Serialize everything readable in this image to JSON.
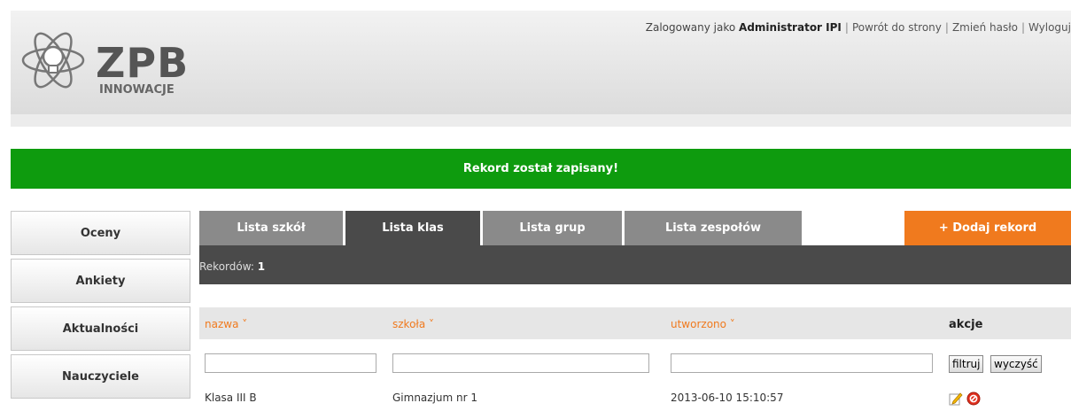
{
  "header": {
    "logo_title": "ZPB",
    "logo_subtitle": "INNOWACJE",
    "user_prefix": "Zalogowany jako",
    "user_name": "Administrator IPI",
    "links": [
      "Powrót do strony",
      "Zmień hasło",
      "Wyloguj"
    ]
  },
  "flash": {
    "message": "Rekord został zapisany!",
    "color": "#0e9b0e"
  },
  "sidebar": {
    "items": [
      {
        "label": "Oceny"
      },
      {
        "label": "Ankiety"
      },
      {
        "label": "Aktualności"
      },
      {
        "label": "Nauczyciele"
      }
    ]
  },
  "tabs": [
    {
      "label": "Lista szkół",
      "active": false
    },
    {
      "label": "Lista klas",
      "active": true
    },
    {
      "label": "Lista grup",
      "active": false
    },
    {
      "label": "Lista zespołów",
      "active": false
    }
  ],
  "add_button": {
    "label": "+  Dodaj rekord",
    "color": "#f07a1e"
  },
  "records": {
    "label": "Rekordów:",
    "count": "1"
  },
  "table": {
    "columns": [
      "nazwa ˅",
      "szkoła ˅",
      "utworzono ˅",
      "akcje"
    ],
    "filter_buttons": {
      "filter": "filtruj",
      "clear": "wyczyść"
    },
    "rows": [
      {
        "nazwa": "Klasa III B",
        "szkola": "Gimnazjum nr 1",
        "utworzono": "2013-06-10 15:10:57",
        "actions": [
          "edit-icon",
          "delete-icon"
        ]
      }
    ]
  }
}
